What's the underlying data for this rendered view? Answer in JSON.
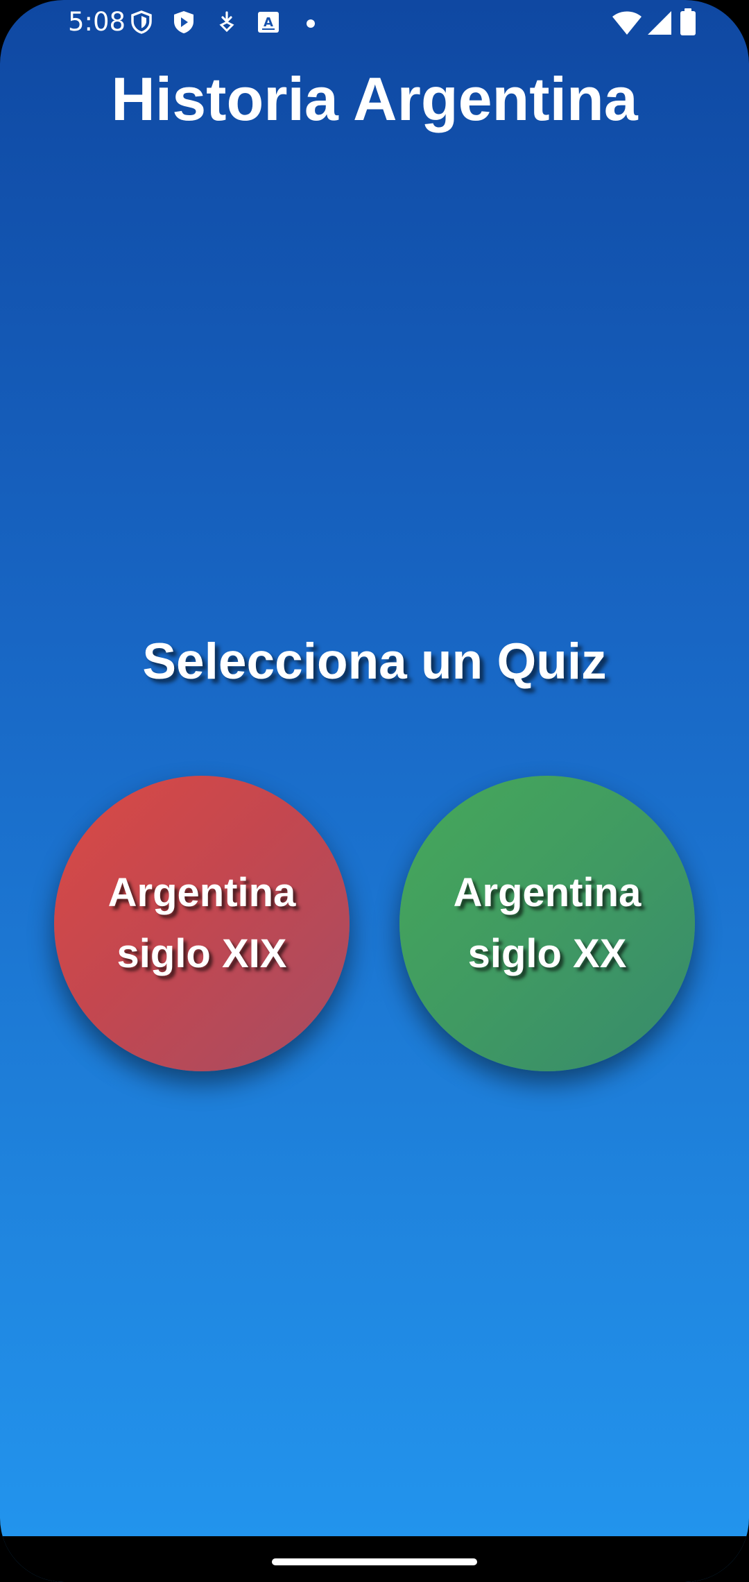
{
  "status_bar": {
    "time": "5:08",
    "left_icons": [
      "shield-icon",
      "play-protect-icon",
      "download-icon",
      "translate-icon",
      "notification-dot-icon"
    ],
    "right_icons": [
      "wifi-icon",
      "signal-icon",
      "battery-icon"
    ]
  },
  "header": {
    "title": "Historia Argentina"
  },
  "main": {
    "subtitle": "Selecciona un Quiz",
    "quizzes": [
      {
        "line1": "Argentina",
        "line2": "siglo XIX",
        "color": "#c9474f"
      },
      {
        "line1": "Argentina",
        "line2": "siglo XX",
        "color": "#409a62"
      }
    ]
  },
  "colors": {
    "background_top": "#0f48a2",
    "background_bottom": "#2396ef"
  }
}
